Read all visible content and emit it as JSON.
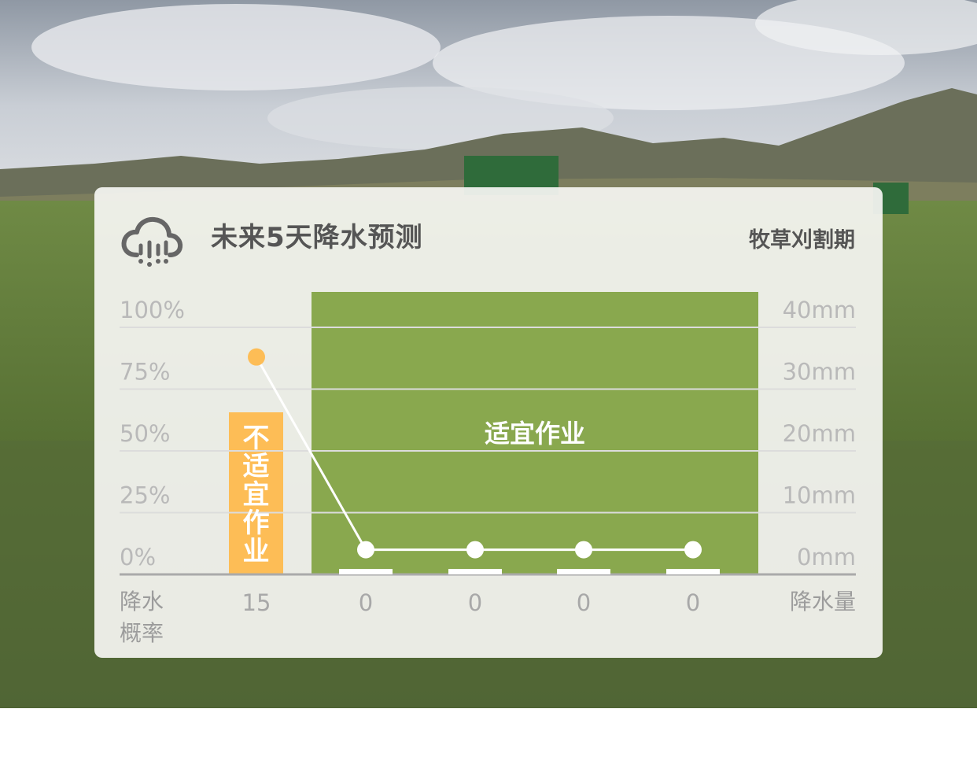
{
  "card": {
    "title": "未来5天降水预测",
    "subtitle": "牧草刈割期"
  },
  "colors": {
    "good": "#89a84e",
    "bad": "#fdbd56",
    "line": "#ffffff",
    "grid": "#dcdcdc",
    "axis": "#aaaaaa"
  },
  "icons": {
    "title_icon": "rain-cloud-icon"
  },
  "chart_data": {
    "type": "line",
    "title": "未来5天降水预测",
    "left_axis": {
      "label": "降水概率",
      "ticks": [
        "100%",
        "75%",
        "50%",
        "25%",
        "0%"
      ],
      "range": [
        0,
        100
      ],
      "unit": "%"
    },
    "right_axis": {
      "label": "降水量",
      "ticks": [
        "40mm",
        "30mm",
        "20mm",
        "10mm",
        "0mm"
      ],
      "range": [
        0,
        40
      ],
      "unit": "mm"
    },
    "series": [
      {
        "name": "降水概率",
        "axis": "left",
        "type": "line",
        "values": [
          88,
          10,
          10,
          10,
          10
        ]
      },
      {
        "name": "降水量",
        "axis": "right",
        "type": "bar",
        "values": [
          0,
          0.5,
          0.5,
          0.5,
          0.5
        ]
      }
    ],
    "value_labels": [
      "15",
      "0",
      "0",
      "0",
      "0"
    ],
    "bands": [
      {
        "label": "不适宜作业",
        "days": [
          0,
          0
        ],
        "color": "#fdbd56"
      },
      {
        "label": "适宜作业",
        "days": [
          1,
          4
        ],
        "color": "#89a84e"
      }
    ],
    "grid": true
  }
}
